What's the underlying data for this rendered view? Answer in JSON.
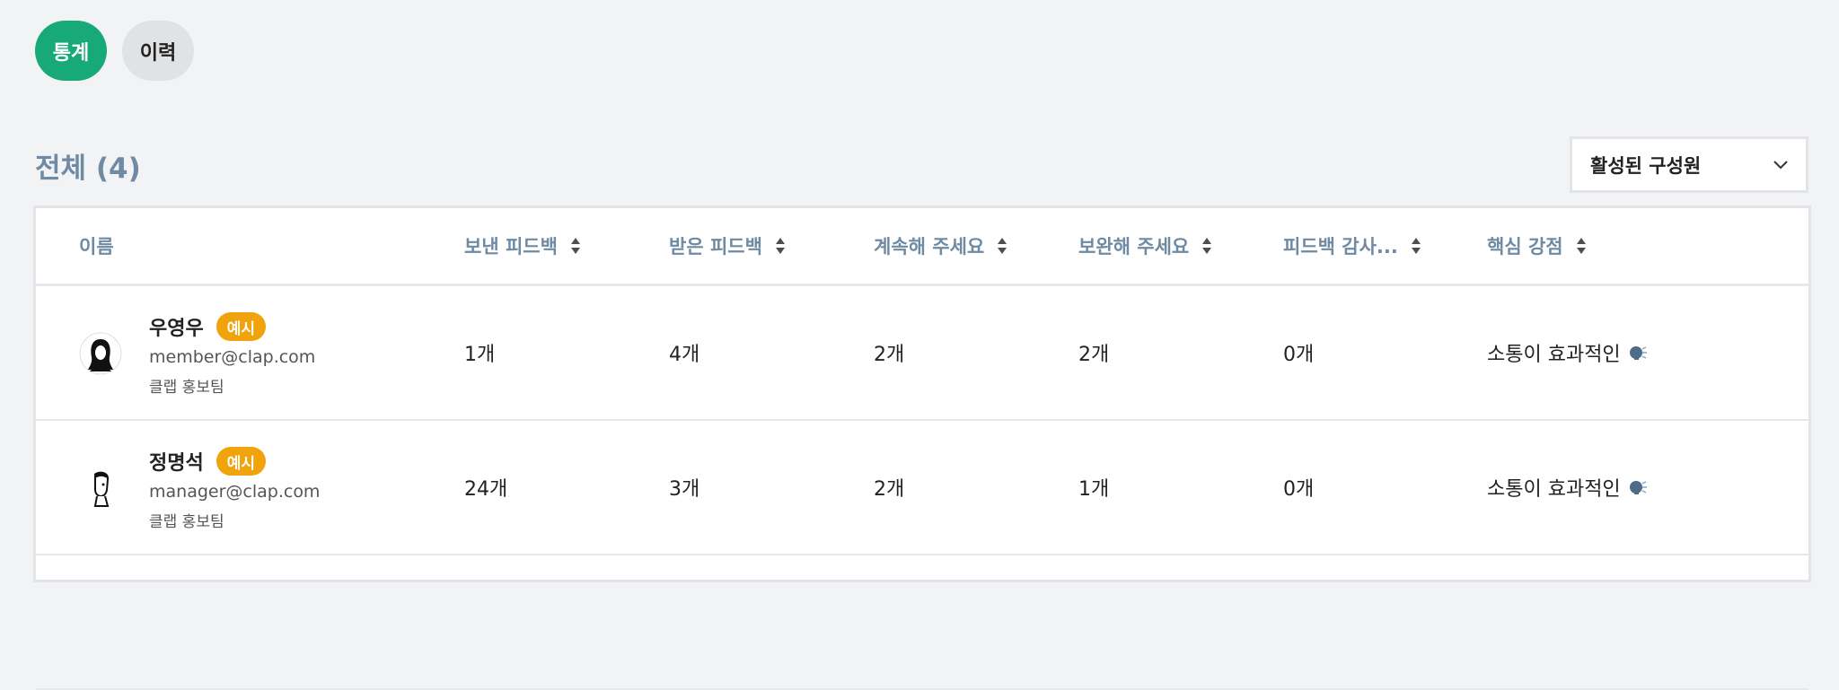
{
  "tabs": [
    {
      "label": "통계",
      "active": true
    },
    {
      "label": "이력",
      "active": false
    }
  ],
  "section": {
    "title": "전체 (4)"
  },
  "filter": {
    "selected": "활성된 구성원"
  },
  "table": {
    "columns": [
      "이름",
      "보낸 피드백",
      "받은 피드백",
      "계속해 주세요",
      "보완해 주세요",
      "피드백 감사...",
      "핵심 강점"
    ],
    "rows": [
      {
        "name": "우영우",
        "badge": "예시",
        "email": "member@clap.com",
        "team": "클랩 홍보팀",
        "sent": "1개",
        "received": "4개",
        "keep": "2개",
        "improve": "2개",
        "thanks": "0개",
        "strength": "소통이 효과적인",
        "strength_icon": "speaking-head-icon"
      },
      {
        "name": "정명석",
        "badge": "예시",
        "email": "manager@clap.com",
        "team": "클랩 홍보팀",
        "sent": "24개",
        "received": "3개",
        "keep": "2개",
        "improve": "1개",
        "thanks": "0개",
        "strength": "소통이 효과적인",
        "strength_icon": "speaking-head-icon"
      }
    ]
  },
  "colors": {
    "accent": "#17a978",
    "badge": "#f0a30a",
    "header_text": "#6f8aa3",
    "background": "#f2f3f5"
  }
}
